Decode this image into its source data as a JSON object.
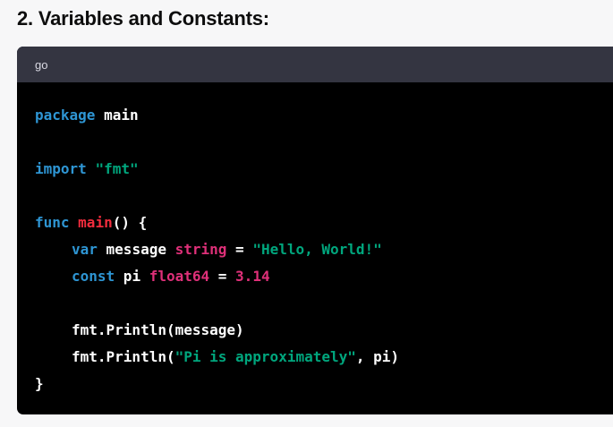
{
  "heading": "2. Variables and Constants:",
  "code_block": {
    "language": "go",
    "colors": {
      "header_bg": "#343541",
      "body_bg": "#000000",
      "keyword": "#2e95d3",
      "string": "#00a67d",
      "function": "#f22c3d",
      "type": "#df3079",
      "plain": "#ffffff"
    },
    "lines": {
      "l1": {
        "kw": "package",
        "rest": " main"
      },
      "l2": {
        "kw": "import",
        "str": "\"fmt\""
      },
      "l3": {
        "kw": "func",
        "fn": "main",
        "rest": "() {"
      },
      "l4": {
        "kw": "var",
        "name": " message ",
        "type": "string",
        "eq": " = ",
        "str": "\"Hello, World!\""
      },
      "l5": {
        "kw": "const",
        "name": " pi ",
        "type": "float64",
        "eq": " = ",
        "num": "3.14"
      },
      "l6": {
        "call": "fmt.Println(message)"
      },
      "l7": {
        "call": "fmt.Println(",
        "str": "\"Pi is approximately\"",
        "rest": ", pi)"
      },
      "l8": {
        "rest": "}"
      }
    }
  }
}
